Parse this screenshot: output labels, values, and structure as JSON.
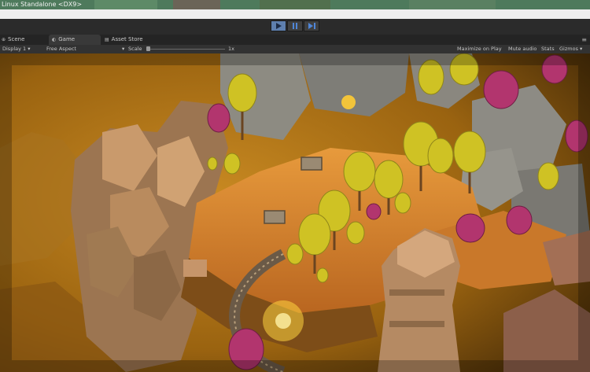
{
  "window": {
    "title": "Linux Standalone <DX9>"
  },
  "toolbar": {
    "play_icon": "play-icon",
    "pause_icon": "pause-icon",
    "step_icon": "step-icon"
  },
  "tabs": [
    {
      "label": "Scene",
      "icon": "scene-icon"
    },
    {
      "label": "Game",
      "icon": "game-icon"
    },
    {
      "label": "Asset Store",
      "icon": "store-icon"
    }
  ],
  "gamebar": {
    "display": "Display 1",
    "aspect": "Free Aspect",
    "scale_label": "Scale",
    "scale_value": "1x",
    "maximize_on_play": "Maximize on Play",
    "mute_audio": "Mute audio",
    "stats": "Stats",
    "gizmos": "Gizmos"
  },
  "colors": {
    "titlebar": "#4e7a5c",
    "play_active": "#5e7fae",
    "panel": "#323232"
  }
}
